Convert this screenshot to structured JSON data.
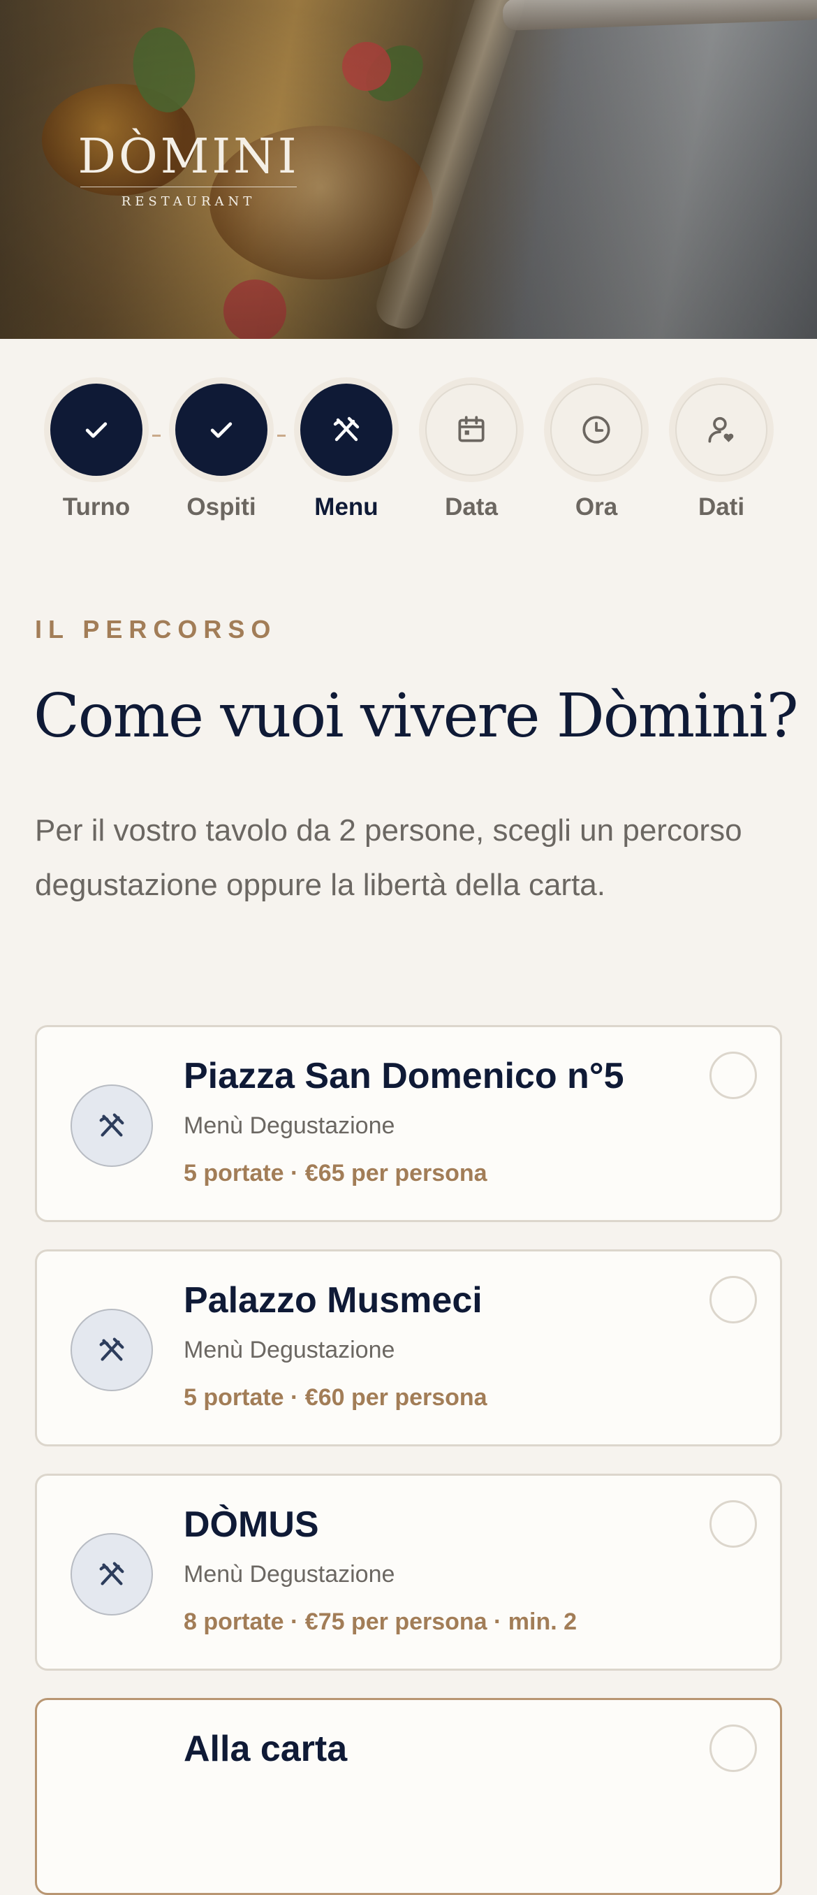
{
  "hero": {
    "logo_name": "DÒMINI",
    "logo_sub": "RESTAURANT"
  },
  "stepper": {
    "steps": [
      {
        "label": "Turno",
        "state": "done",
        "icon": "check-icon"
      },
      {
        "label": "Ospiti",
        "state": "done",
        "icon": "check-icon"
      },
      {
        "label": "Menu",
        "state": "active",
        "icon": "fork-knife-icon"
      },
      {
        "label": "Data",
        "state": "todo",
        "icon": "calendar-icon"
      },
      {
        "label": "Ora",
        "state": "todo",
        "icon": "clock-icon"
      },
      {
        "label": "Dati",
        "state": "todo",
        "icon": "user-heart-icon"
      }
    ]
  },
  "intro": {
    "eyebrow": "IL PERCORSO",
    "headline": "Come vuoi vivere Dòmini?",
    "lead": "Per il vostro tavolo da 2 persone, scegli un percorso degustazione oppure la libertà della carta."
  },
  "menus": [
    {
      "title": "Piazza San Domenico n°5",
      "type": "Menù Degustazione",
      "meta": "5 portate · €65 per persona"
    },
    {
      "title": "Palazzo Musmeci",
      "type": "Menù Degustazione",
      "meta": "5 portate · €60 per persona"
    },
    {
      "title": "DÒMUS",
      "type": "Menù Degustazione",
      "meta": "8 portate · €75 per persona · min. 2"
    },
    {
      "title": "Alla carta",
      "type": "",
      "meta": ""
    }
  ],
  "colors": {
    "navy": "#0f1a36",
    "accent": "#a27d57",
    "background": "#f6f3ee"
  }
}
